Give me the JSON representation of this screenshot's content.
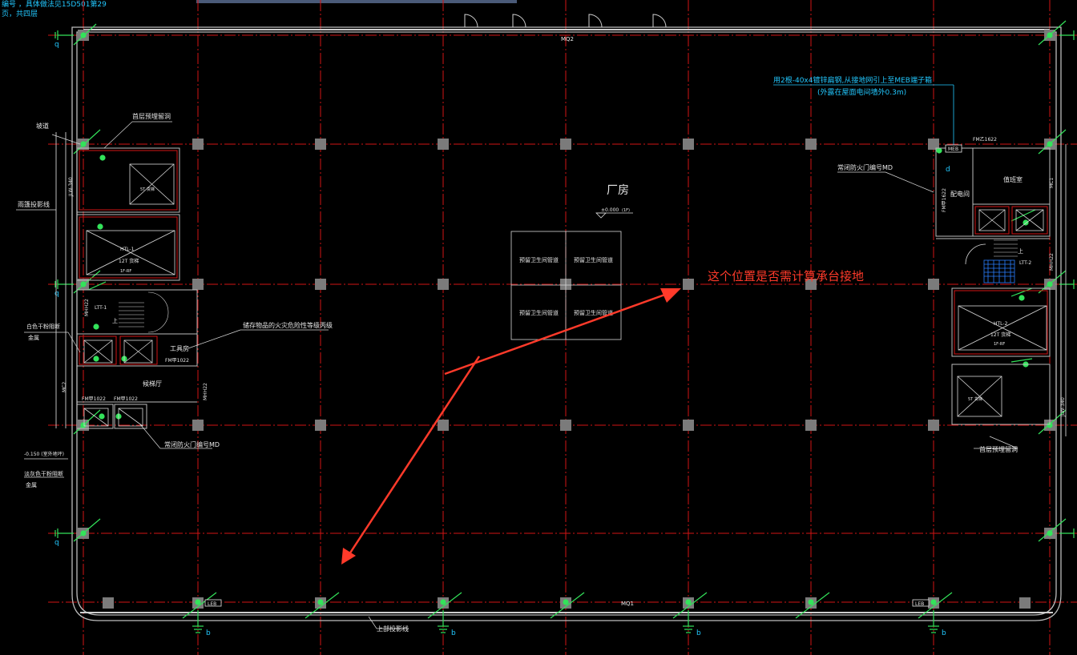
{
  "top_note": {
    "line1": "编号 ，具体做法见15D501第29",
    "line2": "页，共四层"
  },
  "labels": {
    "doors": {
      "top_main": "MQ2",
      "bottom_main": "MQ1",
      "fm_top_right": "FM乙1622",
      "fm_vertical_right": "FM甲1622",
      "mhh_right": "MHH22",
      "mhh_left": "MHH22",
      "mhh_left_lower": "MHH22",
      "fm_left_1": "FM甲1022",
      "fm_left_2": "FM甲1022",
      "fm_left_3": "FM甲1022",
      "mc2_left": "MC2",
      "mc1_right": "MC1"
    },
    "rooms": {
      "factory": "厂房",
      "elevation": "±0.000",
      "elevation_sub": "(1F)",
      "power_room": "配电间",
      "duty_room": "值班室",
      "tool_room": "工具房",
      "stair_hall": "候梯厅",
      "ramp": "坡道",
      "lt1": "LTT-1",
      "lt2": "LTT-2",
      "htl1": "HTL-1",
      "htl2": "HTL-2",
      "elevator_note": "12T 货梯",
      "elevator_floor": "1F-RF",
      "small_lift": "5T 货梯",
      "up_arrow": "上"
    },
    "fixtures": {
      "box1": "预留卫生间管道",
      "box2": "预留卫生间管道",
      "box3": "预留卫生间管道",
      "box4": "预留卫生间管道"
    },
    "leaders": {
      "first_floor_hole": "首层预埋留洞",
      "rain_shed": "雨篷投影线",
      "steel_door_1": "白色干粉阻断",
      "steel_door_1b": "金属",
      "dangerous_goods": "储存物品的火灾危险性等级丙级",
      "fire_door": "常闭防火门编号MD",
      "elev_label": "-0.150 (室外地坪)",
      "steel_door_2": "淡灰色干粉阻断",
      "steel_door_2b": "金属",
      "upper_projection": "上部投影线",
      "fire_door_right": "常闭防火门编号MD",
      "first_floor_hole_right": "首层预埋留洞",
      "jlw_left": "JLW-340",
      "jlw_right": "JLW-340"
    },
    "grounding_note": {
      "line1": "用2根-40x4镀锌扁钢,从接地网引上至MEB端子箱",
      "line2": "(外露在屋面电间墙外0.3m)"
    },
    "meb_label": "MEB",
    "leb_label": "LEB",
    "ground_b": "b",
    "ground_q": "q",
    "ground_d": "d"
  },
  "annotation": {
    "question": "这个位置是否需计算承台接地",
    "color": "#ff3a2a"
  },
  "colors": {
    "background": "#000000",
    "axis": "#d21414",
    "wall": "#bdbdbd",
    "column": "#7b7b7b",
    "ground_symbol": "#33e35a",
    "annotation_arrow": "#ff3a2a",
    "cyan_text": "#22c8ff",
    "top_bar": "#4a5a78"
  }
}
